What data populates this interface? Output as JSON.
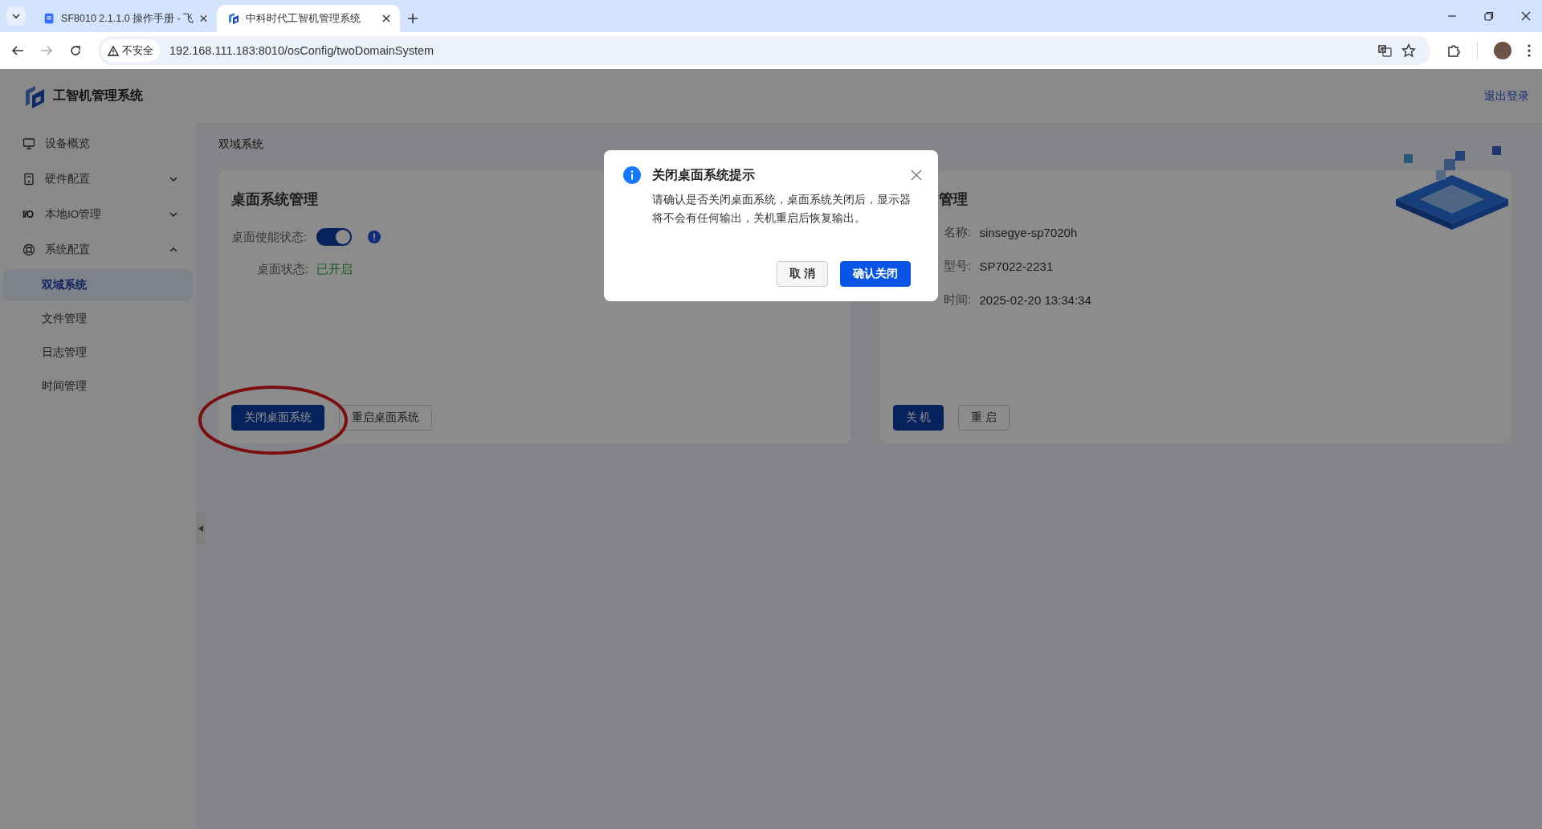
{
  "browser": {
    "tabs": [
      {
        "title": "SF8010 2.1.1.0 操作手册 - 飞",
        "kind": "doc",
        "selected": false
      },
      {
        "title": "中科时代工智机管理系统",
        "kind": "app",
        "selected": true
      }
    ],
    "security_label": "不安全",
    "url": "192.168.111.183:8010/osConfig/twoDomainSystem"
  },
  "app": {
    "title": "工智机管理系统",
    "logout": "退出登录"
  },
  "sidebar": {
    "items": [
      {
        "label": "设备概览"
      },
      {
        "label": "硬件配置",
        "expanded": false
      },
      {
        "label": "本地IO管理",
        "icon_text": "I/O",
        "expanded": false
      },
      {
        "label": "系统配置",
        "expanded": true,
        "children": [
          {
            "label": "双域系统",
            "selected": true
          },
          {
            "label": "文件管理",
            "selected": false
          },
          {
            "label": "日志管理",
            "selected": false
          },
          {
            "label": "时间管理",
            "selected": false
          }
        ]
      }
    ]
  },
  "breadcrumb": "双域系统",
  "desktop_card": {
    "title": "桌面系统管理",
    "toggle": {
      "label": "桌面使能状态:",
      "on": true
    },
    "status": {
      "label": "桌面状态:",
      "value": "已开启"
    },
    "buttons": [
      {
        "label": "关闭桌面系统",
        "kind": "primary"
      },
      {
        "label": "重启桌面系统",
        "kind": "default"
      }
    ]
  },
  "host_card": {
    "title": "管理",
    "rows": [
      {
        "label": "名称:",
        "value": "sinsegye-sp7020h"
      },
      {
        "label": "型号:",
        "value": "SP7022-2231"
      },
      {
        "label": "时间:",
        "value": "2025-02-20 13:34:34"
      }
    ],
    "buttons": [
      {
        "label": "关 机",
        "kind": "primary"
      },
      {
        "label": "重 启",
        "kind": "default"
      }
    ]
  },
  "dialog": {
    "title": "关闭桌面系统提示",
    "message": "请确认是否关闭桌面系统，桌面系统关闭后，显示器将不会有任何输出，关机重启后恢复输出。",
    "buttons": [
      {
        "label": "取 消",
        "kind": "default"
      },
      {
        "label": "确认关闭",
        "kind": "primary"
      }
    ]
  }
}
